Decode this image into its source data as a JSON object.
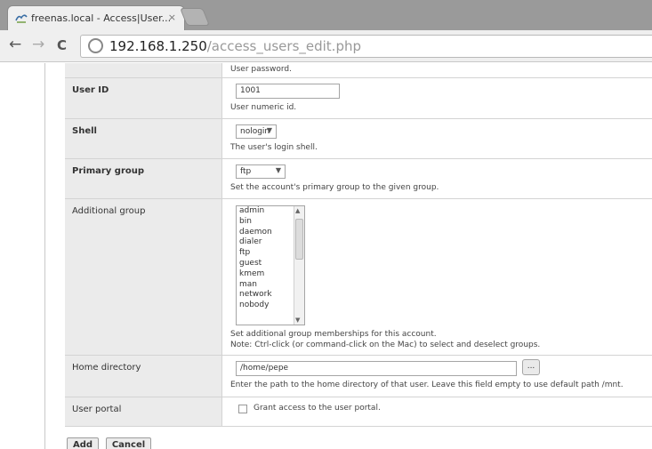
{
  "browser": {
    "tab_title": "freenas.local - Access|User...",
    "tab_close": "×",
    "nav": {
      "back": "←",
      "forward": "→",
      "reload": "C"
    },
    "url_host": "192.168.1.250",
    "url_path": "/access_users_edit.php"
  },
  "form": {
    "password_desc": "User password.",
    "user_id": {
      "label": "User ID",
      "value": "1001",
      "desc": "User numeric id."
    },
    "shell": {
      "label": "Shell",
      "value": "nologin",
      "desc": "The user's login shell."
    },
    "primary_group": {
      "label": "Primary group",
      "value": "ftp",
      "desc": "Set the account's primary group to the given group."
    },
    "additional_group": {
      "label": "Additional group",
      "options": [
        "admin",
        "bin",
        "daemon",
        "dialer",
        "ftp",
        "guest",
        "kmem",
        "man",
        "network",
        "nobody"
      ],
      "desc1": "Set additional group memberships for this account.",
      "desc2": "Note: Ctrl-click (or command-click on the Mac) to select and deselect groups."
    },
    "home_directory": {
      "label": "Home directory",
      "value": "/home/pepe",
      "browse": "...",
      "desc": "Enter the path to the home directory of that user. Leave this field empty to use default path /mnt."
    },
    "user_portal": {
      "label": "User portal",
      "checkbox_label": "Grant access to the user portal.",
      "checked": false
    }
  },
  "actions": {
    "add": "Add",
    "cancel": "Cancel"
  },
  "colors": {
    "label_bg": "#ebebeb",
    "row_border": "#d3d3d3"
  }
}
